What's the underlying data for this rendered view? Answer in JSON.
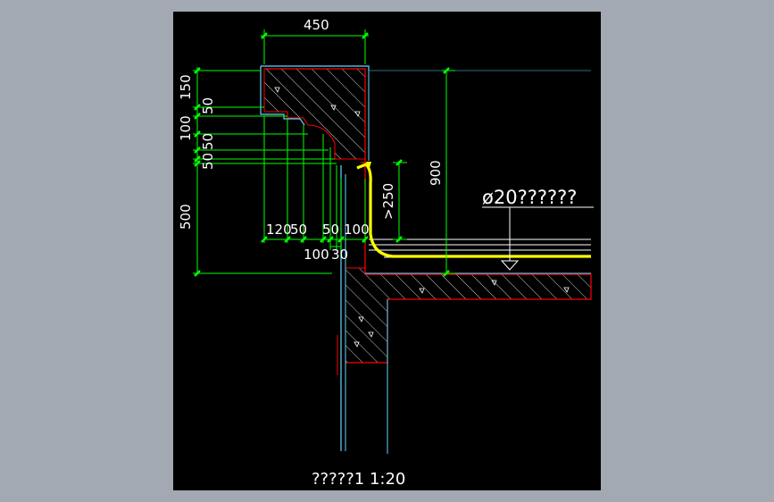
{
  "drawing": {
    "caption": "?????1  1:20",
    "note": "ø20??????",
    "dimensions": {
      "top_width": "450",
      "height_900": "900",
      "min_250": ">250",
      "left_150": "150",
      "left_50a": "50",
      "left_100": "100",
      "left_50b": "50",
      "left_50c": "50",
      "left_500": "500",
      "row_120": "120",
      "row_50a": "50",
      "row_50b": "50",
      "row_100a": "100",
      "row_100b": "100",
      "row_30": "30"
    }
  },
  "colors": {
    "background": "#a3a9b3",
    "canvas": "#000000",
    "dimension": "#00ff00",
    "outline_cyan": "#5fd7ff",
    "outline_red": "#ff0000",
    "waterproof_yellow": "#ffff00",
    "hatch": "#ffffff"
  }
}
